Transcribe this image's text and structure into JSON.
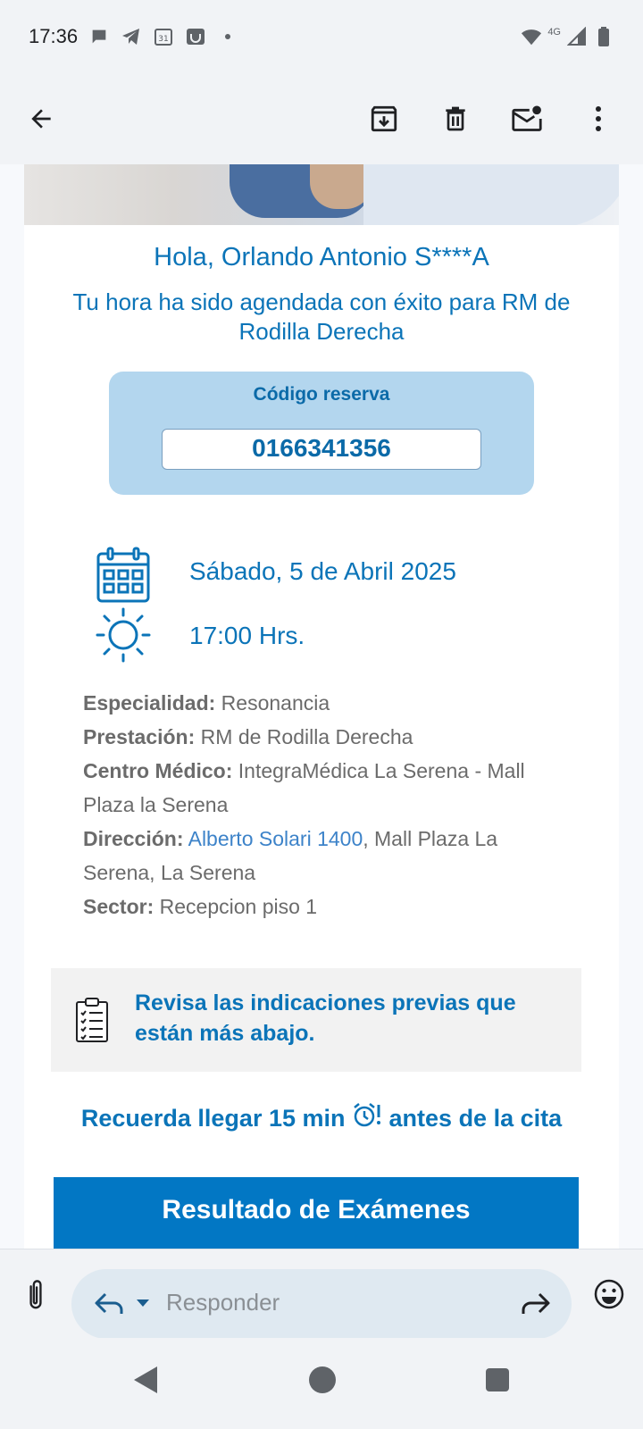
{
  "status_bar": {
    "time": "17:36",
    "network": "4G",
    "left_icons": [
      "chat-bubble-icon",
      "telegram-icon",
      "calendar-31-icon",
      "mailbox-icon",
      "dot-icon"
    ],
    "right_icons": [
      "wifi-icon",
      "signal-icon",
      "battery-icon"
    ]
  },
  "toolbar": {
    "back": "back-arrow-icon",
    "actions": [
      "archive-icon",
      "trash-icon",
      "mark-unread-icon",
      "more-vert-icon"
    ]
  },
  "email": {
    "greeting": "Hola, Orlando Antonio S****A",
    "subtitle": "Tu hora ha sido agendada con éxito para RM de Rodilla Derecha",
    "code_label": "Código reserva",
    "code_value": "0166341356",
    "date": "Sábado, 5 de Abril 2025",
    "time": "17:00 Hrs.",
    "details": {
      "especialidad_label": "Especialidad:",
      "especialidad_value": "Resonancia",
      "prestacion_label": "Prestación:",
      "prestacion_value": "RM de Rodilla Derecha",
      "centro_label": "Centro Médico:",
      "centro_value": "IntegraMédica La Serena - Mall Plaza la Serena",
      "direccion_label": "Dirección:",
      "direccion_link": "Alberto Solari 1400",
      "direccion_rest": ", Mall Plaza La Serena, La Serena",
      "sector_label": "Sector:",
      "sector_value": "Recepcion piso 1"
    },
    "notice": "Revisa las indicaciones previas que están más abajo.",
    "remind_before": "Recuerda llegar 15 min",
    "remind_after": "antes de la cita",
    "results_button": "Resultado de Exámenes"
  },
  "reply": {
    "placeholder": "Responder"
  },
  "colors": {
    "primary": "#0b74b8",
    "button": "#0277c4",
    "code_bg": "#b3d6ee",
    "link": "#3d83c9"
  }
}
